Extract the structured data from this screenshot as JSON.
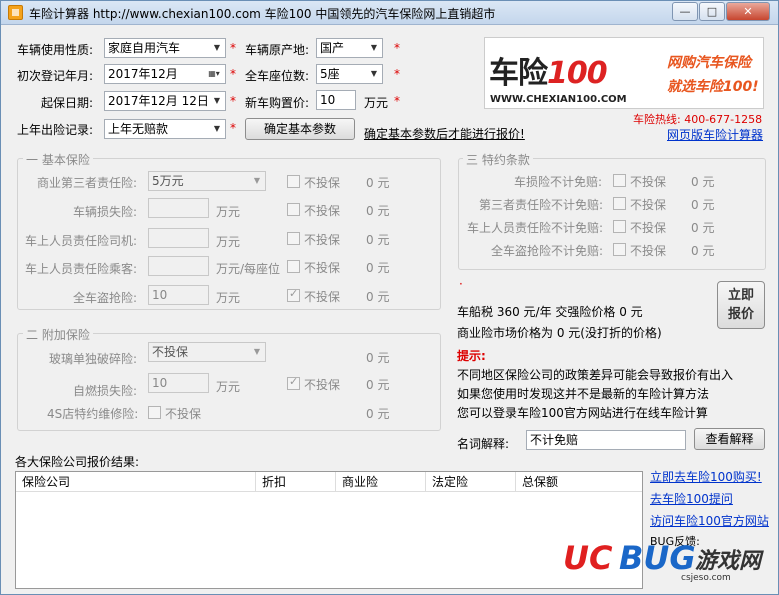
{
  "window": {
    "title": "车险计算器 http://www.chexian100.com 车险100 中国领先的汽车保险网上直销超市",
    "min": "—",
    "max": "□",
    "close": "✕"
  },
  "form": {
    "usage_label": "车辆使用性质:",
    "usage_value": "家庭自用汽车",
    "origin_label": "车辆原产地:",
    "origin_value": "国产",
    "reg_label": "初次登记年月:",
    "reg_value": "2017年12月",
    "seats_label": "全车座位数:",
    "seats_value": "5座",
    "start_label": "起保日期:",
    "start_value": "2017年12月 12日",
    "price_label": "新车购置价:",
    "price_value": "10",
    "price_unit": "万元",
    "claims_label": "上年出险记录:",
    "claims_value": "上年无赔款",
    "confirm_button": "确定基本参数",
    "confirm_hint": "确定基本参数后才能进行报价!",
    "star": "*"
  },
  "ad": {
    "logo_text": "车险",
    "logo_num": "100",
    "url": "WWW.CHEXIAN100.COM",
    "slogan1": "网购汽车保险",
    "slogan2": "就选车险100!",
    "hotline": "车险热线: 400-677-1258",
    "web_calc_link": "网页版车险计算器"
  },
  "basic": {
    "title": "一 基本保险",
    "third_party_label": "商业第三者责任险:",
    "third_party_value": "5万元",
    "damage_label": "车辆损失险:",
    "driver_label": "车上人员责任险司机:",
    "passenger_label": "车上人员责任险乘客:",
    "theft_label": "全车盗抢险:",
    "theft_value": "10",
    "unit_wan": "万元",
    "unit_per_seat": "万元/每座位",
    "not_insured": "不投保",
    "zero_yuan": "0 元"
  },
  "special": {
    "title": "三 特约条款",
    "items": [
      {
        "label": "车损险不计免赔:"
      },
      {
        "label": "第三者责任险不计免赔:"
      },
      {
        "label": "车上人员责任险不计免赔:"
      },
      {
        "label": "全车盗抢险不计免赔:"
      }
    ],
    "not_insured": "不投保",
    "zero_yuan": "0 元"
  },
  "extra": {
    "title": "二 附加保险",
    "glass_label": "玻璃单独破碎险:",
    "glass_value": "不投保",
    "fire_label": "自燃损失险:",
    "fire_value": "10",
    "s4_label": "4S店特约维修险:",
    "unit_wan": "万元",
    "not_insured": "不投保",
    "zero_yuan": "0 元"
  },
  "summary": {
    "dot": "·",
    "tax_line": "车船税  360 元/年    交强险价格 0 元",
    "market_line": "商业险市场价格为 0 元(没打折的价格)",
    "quote_button_line1": "立即",
    "quote_button_line2": "报价",
    "tip_label": "提示:",
    "tip1": "不同地区保险公司的政策差异可能会导致报价有出入",
    "tip2": "如果您使用时发现这并不是最新的车险计算方法",
    "tip3": "您可以登录车险100官方网站进行在线车险计算",
    "term_label": "名词解释:",
    "term_value": "不计免赔",
    "term_button": "查看解释"
  },
  "results": {
    "title": "各大保险公司报价结果:",
    "columns": [
      "保险公司",
      "折扣",
      "商业险",
      "法定险",
      "总保额"
    ]
  },
  "links": {
    "buy": "立即去车险100购买!",
    "ask": "去车险100提问",
    "site": "访问车险100官方网站",
    "bug": "BUG反馈:"
  },
  "watermark": {
    "uc": "UC",
    "bug": "BUG",
    "cn": "游戏网",
    "url": "csjeso.com"
  },
  "colors": {
    "accent_red": "#d00000",
    "link_blue": "#0033cc",
    "ad_orange": "#e8561f"
  }
}
